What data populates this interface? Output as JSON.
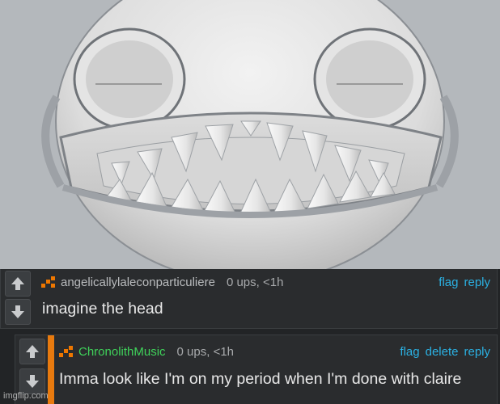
{
  "comments": [
    {
      "username": "angelicallylaleconparticuliere",
      "stats": "0 ups, <1h",
      "text": "imagine the head",
      "actions": {
        "flag": "flag",
        "reply": "reply"
      }
    },
    {
      "username": "ChronolithMusic",
      "stats": "0 ups, <1h",
      "text": "Imma look like I'm on my period when I'm done with claire",
      "actions": {
        "flag": "flag",
        "delete": "delete",
        "reply": "reply"
      }
    }
  ],
  "watermark": "imgflip.com",
  "colors": {
    "link": "#2bb2e4",
    "rank": "#ee7700",
    "reply_bar": "#e87a0e",
    "username_highlight": "#3fd25a"
  },
  "icons": [
    "upvote-arrow-icon",
    "downvote-arrow-icon",
    "user-rank-icon"
  ]
}
